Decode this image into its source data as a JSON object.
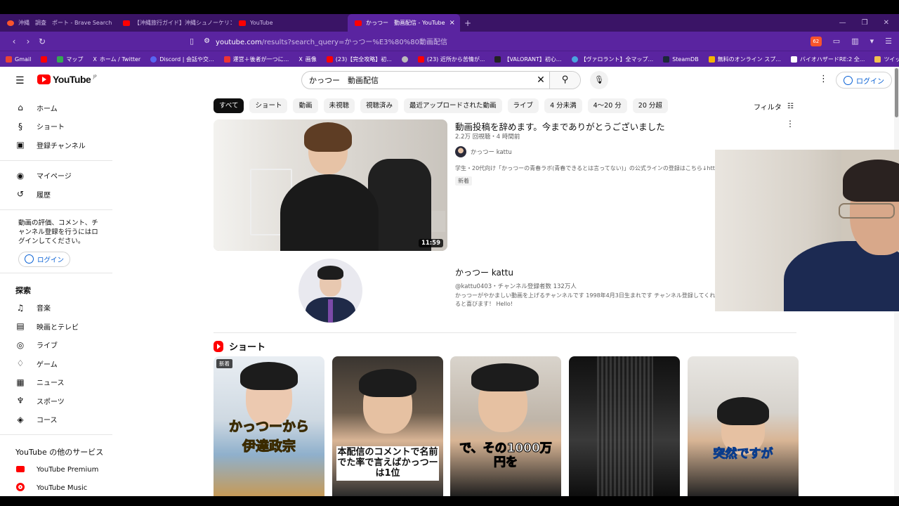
{
  "browser": {
    "tabs": [
      {
        "title": "沖縄　調査　ポート - Brave Search",
        "type": "brave",
        "active": false
      },
      {
        "title": "【沖縄旅行ガイド】沖縄シュノーケリング...",
        "type": "yt",
        "active": false
      },
      {
        "title": "YouTube",
        "type": "yt",
        "active": false
      },
      {
        "title": "かっつー　動画配信 - YouTube",
        "type": "yt",
        "active": true
      }
    ],
    "url_host": "youtube.com",
    "url_rest": "/results?search_query=かっつー%E3%80%80動画配信",
    "shield_count": "62",
    "bookmarks": [
      "Gmail",
      "",
      "マップ",
      "ホーム / Twitter",
      "Discord | 会話や交...",
      "運営＋後者が一つに...",
      "X",
      "画像",
      "(23)【完全攻略】初...",
      "",
      "(23) 近所から苦情が...",
      "【VALORANT】初心...",
      "【ヴァロラント】全マップ...",
      "SteamDB",
      "無料のオンライン スプ...",
      "バイオハザードRE:2 全...",
      "ツイッチ関連"
    ]
  },
  "youtube": {
    "logo": "YouTube",
    "logo_region": "JP",
    "search_value": "かっつー　動画配信",
    "login_label": "ログイン",
    "sidebar": {
      "main": [
        {
          "label": "ホーム",
          "icon": "home-icon"
        },
        {
          "label": "ショート",
          "icon": "shorts-icon"
        },
        {
          "label": "登録チャンネル",
          "icon": "subscriptions-icon"
        }
      ],
      "you": [
        {
          "label": "マイページ",
          "icon": "my-page-icon"
        },
        {
          "label": "履歴",
          "icon": "history-icon"
        }
      ],
      "login_note": "動画の評価、コメント、チャンネル登録を行うにはログインしてください。",
      "login_label": "ログイン",
      "explore_title": "探索",
      "explore": [
        {
          "label": "音楽",
          "icon": "music-icon"
        },
        {
          "label": "映画とテレビ",
          "icon": "movies-icon"
        },
        {
          "label": "ライブ",
          "icon": "live-icon"
        },
        {
          "label": "ゲーム",
          "icon": "gaming-icon"
        },
        {
          "label": "ニュース",
          "icon": "news-icon"
        },
        {
          "label": "スポーツ",
          "icon": "sports-icon"
        },
        {
          "label": "コース",
          "icon": "courses-icon"
        }
      ],
      "more_title": "YouTube の他のサービス",
      "more": [
        {
          "label": "YouTube Premium"
        },
        {
          "label": "YouTube Music"
        }
      ]
    },
    "chips": [
      "すべて",
      "ショート",
      "動画",
      "未視聴",
      "視聴済み",
      "最近アップロードされた動画",
      "ライブ",
      "4 分未満",
      "4～20 分",
      "20 分超"
    ],
    "filter_label": "フィルタ",
    "video": {
      "title": "動画投稿を辞めます。今までありがとうございました",
      "meta": "2.2万 回視聴・4 時間前",
      "channel": "かっつー kattu",
      "description": "学生・20代向け「かっつーの青春ラボ(青春できるとは言ってない)」の公式ラインの登録はこちら↓https://lin.ee/xMuTLXM ...",
      "badge": "新着",
      "duration": "11:59"
    },
    "channel": {
      "name": "かっつー kattu",
      "meta": "@kattu0403・チャンネル登録者数 132万人",
      "description": "かっつーがやかましい動画を上げるチャンネルです 1998年4月3日生まれです チャンネル登録してくれると喜びます！ Hello!"
    },
    "shorts_title": "ショート",
    "shorts": [
      {
        "badge": "新着",
        "caption1": "かっつーから",
        "caption2": "伊達政宗"
      },
      {
        "badge": "",
        "caption1": "本配信のコメントで名前でた率で言えばかっつーは1位",
        "caption2": ""
      },
      {
        "badge": "",
        "caption1": "で、その1000万円を",
        "caption2": ""
      },
      {
        "badge": "",
        "caption1": "",
        "caption2": ""
      },
      {
        "badge": "",
        "caption1": "突然ですが",
        "caption2": ""
      }
    ]
  }
}
